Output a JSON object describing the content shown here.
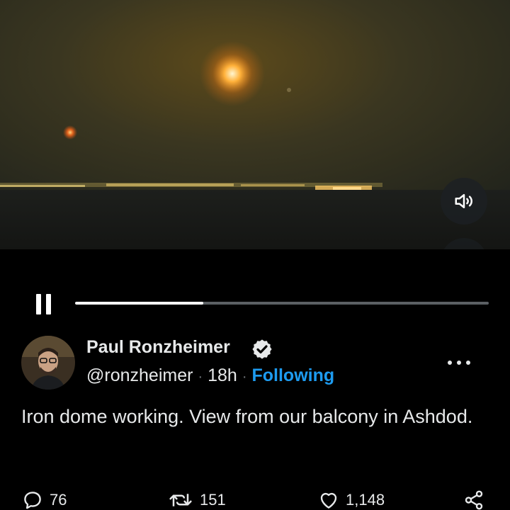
{
  "video": {
    "progress_fraction": 0.31,
    "volume_icon": "speaker-icon",
    "captions_icon": "closed-captions-off-icon",
    "playback_state": "playing"
  },
  "tweet": {
    "author": {
      "display_name": "Paul Ronzheimer",
      "handle": "@ronzheimer",
      "verified": true
    },
    "time_ago": "18h",
    "separator": "·",
    "follow_status": "Following",
    "text": "Iron dome working. View from our balcony in Ashdod.",
    "actions": {
      "replies": "76",
      "retweets": "151",
      "likes": "1,148"
    }
  },
  "colors": {
    "background": "#000000",
    "text": "#e7e9ea",
    "accent": "#1d9bf0",
    "muted": "#71767b"
  }
}
